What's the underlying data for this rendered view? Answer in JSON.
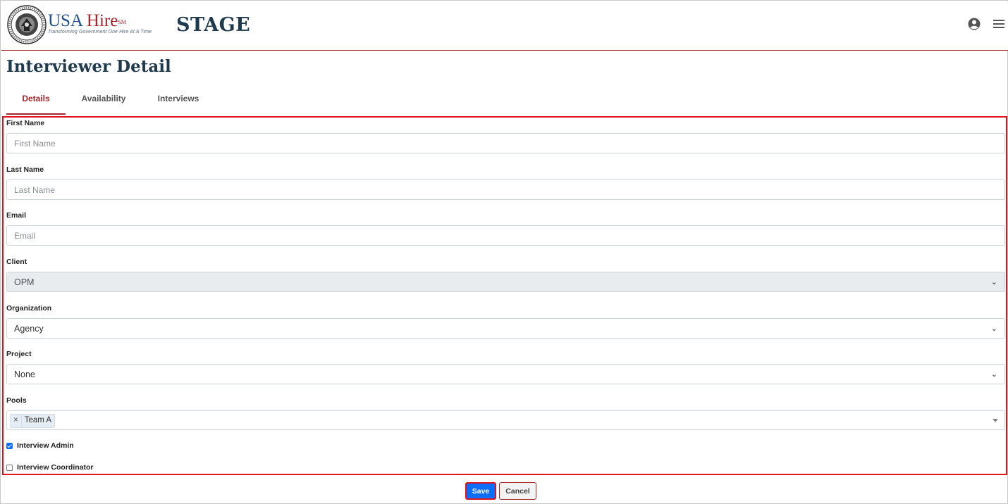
{
  "header": {
    "brand_usa": "USA",
    "brand_hire": "Hire",
    "brand_sm": "SM",
    "tagline": "Transforming Government One Hire At A Time",
    "environment": "STAGE",
    "icons": {
      "user": "user-circle-icon",
      "menu": "hamburger-menu-icon"
    }
  },
  "page": {
    "title": "Interviewer Detail"
  },
  "tabs": [
    {
      "label": "Details",
      "active": true
    },
    {
      "label": "Availability",
      "active": false
    },
    {
      "label": "Interviews",
      "active": false
    }
  ],
  "form": {
    "first_name": {
      "label": "First Name",
      "placeholder": "First Name",
      "value": ""
    },
    "last_name": {
      "label": "Last Name",
      "placeholder": "Last Name",
      "value": ""
    },
    "email": {
      "label": "Email",
      "placeholder": "Email",
      "value": ""
    },
    "client": {
      "label": "Client",
      "value": "OPM",
      "disabled": true
    },
    "organization": {
      "label": "Organization",
      "value": "Agency"
    },
    "project": {
      "label": "Project",
      "value": "None"
    },
    "pools": {
      "label": "Pools",
      "selected": [
        "Team A"
      ],
      "remove_glyph": "×"
    },
    "interview_admin": {
      "label": "Interview Admin",
      "checked": true
    },
    "interview_coordinator": {
      "label": "Interview Coordinator",
      "checked": false
    }
  },
  "actions": {
    "save": "Save",
    "cancel": "Cancel"
  },
  "colors": {
    "accent_red": "#a4262c",
    "highlight_red": "#e3131b",
    "primary_blue": "#0d6efd",
    "title_navy": "#1e3a4c"
  }
}
